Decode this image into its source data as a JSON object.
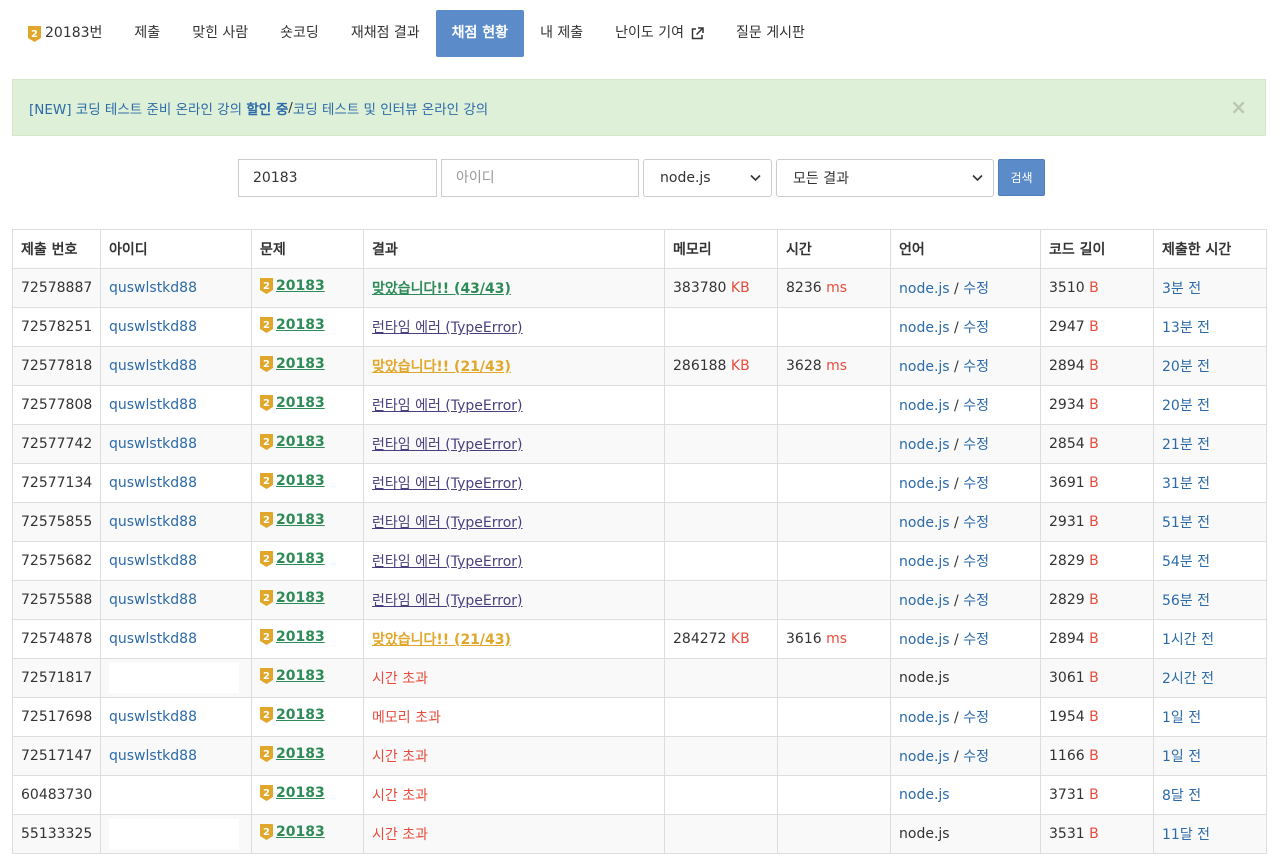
{
  "nav": {
    "problem_label": "20183번",
    "items": [
      {
        "label": "제출"
      },
      {
        "label": "맞힌 사람"
      },
      {
        "label": "숏코딩"
      },
      {
        "label": "재채점 결과"
      },
      {
        "label": "채점 현황"
      },
      {
        "label": "내 제출"
      },
      {
        "label": "난이도 기여"
      },
      {
        "label": "질문 게시판"
      }
    ],
    "active_label": "채점 현황"
  },
  "alert": {
    "link1_prefix": "[NEW] 코딩 테스트 준비 온라인 강의 ",
    "link1_bold": "할인 중",
    "separator": " / ",
    "link2": "코딩 테스트 및 인터뷰 온라인 강의",
    "close": "×"
  },
  "search": {
    "problem_value": "20183",
    "user_placeholder": "아이디",
    "language_value": "node.js",
    "result_value": "모든 결과",
    "button_label": "검색"
  },
  "table": {
    "headers": [
      "제출 번호",
      "아이디",
      "문제",
      "결과",
      "메모리",
      "시간",
      "언어",
      "코드 길이",
      "제출한 시간"
    ],
    "lang_sep": " / ",
    "edit_label": "수정",
    "memory_unit": "KB",
    "time_unit": "ms",
    "length_unit": "B",
    "rows": [
      {
        "id": "72578887",
        "user": "quswlstkd88",
        "problem": "20183",
        "result": "맞았습니다!! (43/43)",
        "result_type": "ac-full",
        "memory": "383780",
        "time": "8236",
        "lang": "node.js",
        "editable": true,
        "length": "3510",
        "submitted": "3분 전"
      },
      {
        "id": "72578251",
        "user": "quswlstkd88",
        "problem": "20183",
        "result": "런타임 에러 (TypeError)",
        "result_type": "rte",
        "memory": "",
        "time": "",
        "lang": "node.js",
        "editable": true,
        "length": "2947",
        "submitted": "13분 전"
      },
      {
        "id": "72577818",
        "user": "quswlstkd88",
        "problem": "20183",
        "result": "맞았습니다!! (21/43)",
        "result_type": "ac-partial",
        "memory": "286188",
        "time": "3628",
        "lang": "node.js",
        "editable": true,
        "length": "2894",
        "submitted": "20분 전"
      },
      {
        "id": "72577808",
        "user": "quswlstkd88",
        "problem": "20183",
        "result": "런타임 에러 (TypeError)",
        "result_type": "rte",
        "memory": "",
        "time": "",
        "lang": "node.js",
        "editable": true,
        "length": "2934",
        "submitted": "20분 전"
      },
      {
        "id": "72577742",
        "user": "quswlstkd88",
        "problem": "20183",
        "result": "런타임 에러 (TypeError)",
        "result_type": "rte",
        "memory": "",
        "time": "",
        "lang": "node.js",
        "editable": true,
        "length": "2854",
        "submitted": "21분 전"
      },
      {
        "id": "72577134",
        "user": "quswlstkd88",
        "problem": "20183",
        "result": "런타임 에러 (TypeError)",
        "result_type": "rte",
        "memory": "",
        "time": "",
        "lang": "node.js",
        "editable": true,
        "length": "3691",
        "submitted": "31분 전"
      },
      {
        "id": "72575855",
        "user": "quswlstkd88",
        "problem": "20183",
        "result": "런타임 에러 (TypeError)",
        "result_type": "rte",
        "memory": "",
        "time": "",
        "lang": "node.js",
        "editable": true,
        "length": "2931",
        "submitted": "51분 전"
      },
      {
        "id": "72575682",
        "user": "quswlstkd88",
        "problem": "20183",
        "result": "런타임 에러 (TypeError)",
        "result_type": "rte",
        "memory": "",
        "time": "",
        "lang": "node.js",
        "editable": true,
        "length": "2829",
        "submitted": "54분 전"
      },
      {
        "id": "72575588",
        "user": "quswlstkd88",
        "problem": "20183",
        "result": "런타임 에러 (TypeError)",
        "result_type": "rte",
        "memory": "",
        "time": "",
        "lang": "node.js",
        "editable": true,
        "length": "2829",
        "submitted": "56분 전"
      },
      {
        "id": "72574878",
        "user": "quswlstkd88",
        "problem": "20183",
        "result": "맞았습니다!! (21/43)",
        "result_type": "ac-partial",
        "memory": "284272",
        "time": "3616",
        "lang": "node.js",
        "editable": true,
        "length": "2894",
        "submitted": "1시간 전"
      },
      {
        "id": "72571817",
        "user": "",
        "problem": "20183",
        "result": "시간 초과",
        "result_type": "red",
        "memory": "",
        "time": "",
        "lang": "node.js",
        "editable": false,
        "length": "3061",
        "submitted": "2시간 전"
      },
      {
        "id": "72517698",
        "user": "quswlstkd88",
        "problem": "20183",
        "result": "메모리 초과",
        "result_type": "red",
        "memory": "",
        "time": "",
        "lang": "node.js",
        "editable": true,
        "length": "1954",
        "submitted": "1일 전"
      },
      {
        "id": "72517147",
        "user": "quswlstkd88",
        "problem": "20183",
        "result": "시간 초과",
        "result_type": "red",
        "memory": "",
        "time": "",
        "lang": "node.js",
        "editable": true,
        "length": "1166",
        "submitted": "1일 전"
      },
      {
        "id": "60483730",
        "user": "",
        "problem": "20183",
        "result": "시간 초과",
        "result_type": "red",
        "memory": "",
        "time": "",
        "lang": "node.js",
        "editable": false,
        "length": "3731",
        "submitted": "8달 전"
      },
      {
        "id": "55133325",
        "user": "",
        "problem": "20183",
        "result": "시간 초과",
        "result_type": "red",
        "memory": "",
        "time": "",
        "lang": "node.js",
        "editable": false,
        "length": "3531",
        "submitted": "11달 전"
      }
    ]
  },
  "colors": {
    "accent": "#5b8cc9",
    "link": "#2c6aa8",
    "accepted": "#2e8b57",
    "partial": "#e0a72a",
    "error": "#e74c3c",
    "runtime": "#4b3e7e",
    "tier_badge": "#e0a72a",
    "alert_bg": "#dff0d8"
  },
  "icons": {
    "tier": "gold-tier-2-icon",
    "external": "external-link-icon",
    "dropdown": "chevron-down-icon",
    "close": "close-icon"
  }
}
